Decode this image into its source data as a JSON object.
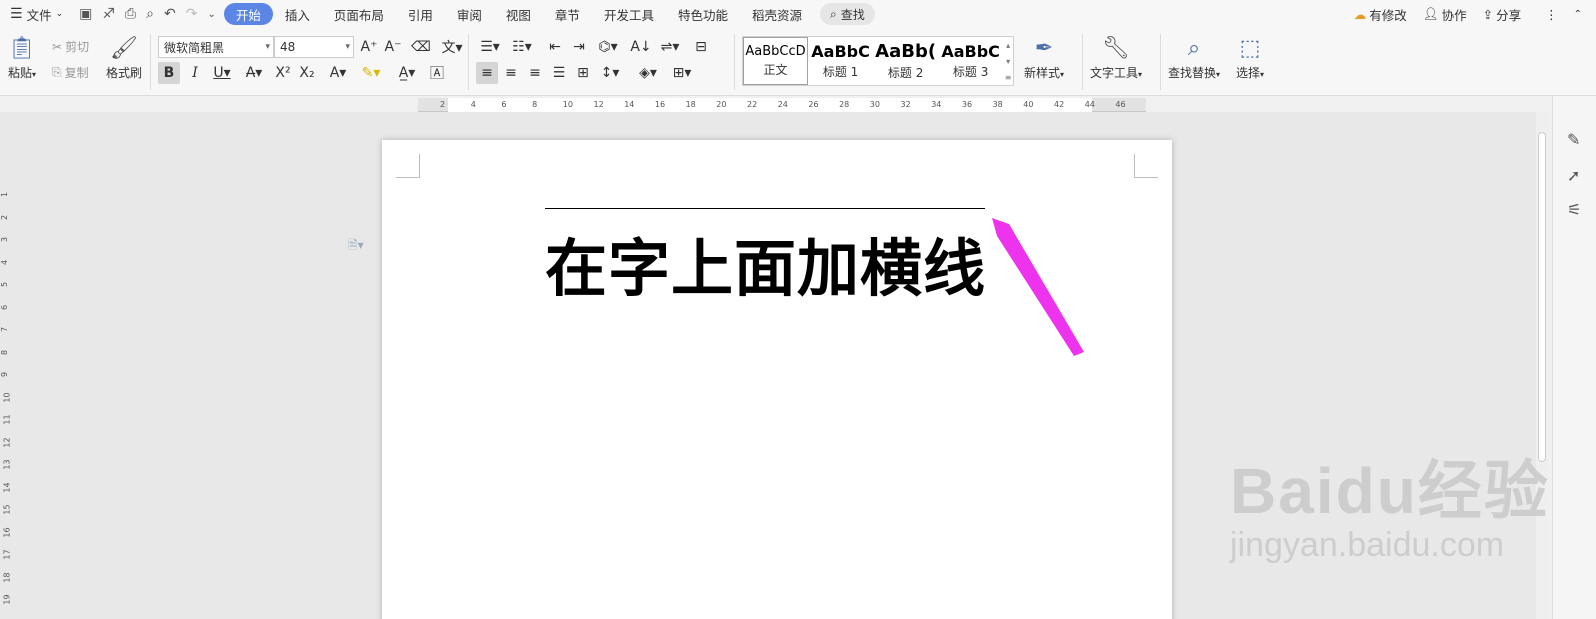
{
  "menu": {
    "file": "文件",
    "tabs": [
      "开始",
      "插入",
      "页面布局",
      "引用",
      "审阅",
      "视图",
      "章节",
      "开发工具",
      "特色功能",
      "稻壳资源"
    ],
    "active_tab": "开始",
    "search": "查找",
    "right": {
      "changes": "有修改",
      "collab": "协作",
      "share": "分享"
    }
  },
  "ribbon": {
    "paste": "粘贴",
    "cut": "剪切",
    "copy": "复制",
    "format_painter": "格式刷",
    "font_name": "微软简粗黑",
    "font_size": "48",
    "styles": [
      {
        "preview": "AaBbCcD",
        "name": "正文"
      },
      {
        "preview": "AaBbC",
        "name": "标题 1"
      },
      {
        "preview": "AaBb(",
        "name": "标题 2"
      },
      {
        "preview": "AaBbC",
        "name": "标题 3"
      }
    ],
    "new_style": "新样式",
    "text_tools": "文字工具",
    "find_replace": "查找替换",
    "select": "选择"
  },
  "ruler": {
    "h_ticks": [
      "2",
      "4",
      "6",
      "8",
      "10",
      "12",
      "14",
      "16",
      "18",
      "20",
      "22",
      "24",
      "26",
      "28",
      "30",
      "32",
      "34",
      "36",
      "38",
      "40",
      "42",
      "44",
      "46"
    ],
    "v_ticks": [
      "1",
      "2",
      "3",
      "4",
      "5",
      "6",
      "7",
      "8",
      "9",
      "10",
      "11",
      "12",
      "13",
      "14",
      "15",
      "16",
      "17",
      "18",
      "19"
    ]
  },
  "document": {
    "heading": "在字上面加横线"
  },
  "annotation": {
    "arrow_color": "#ee33ee"
  },
  "watermark": {
    "line1": "Baidu经验",
    "line2": "jingyan.baidu.com"
  },
  "colors": {
    "accent": "#5b86e5"
  }
}
